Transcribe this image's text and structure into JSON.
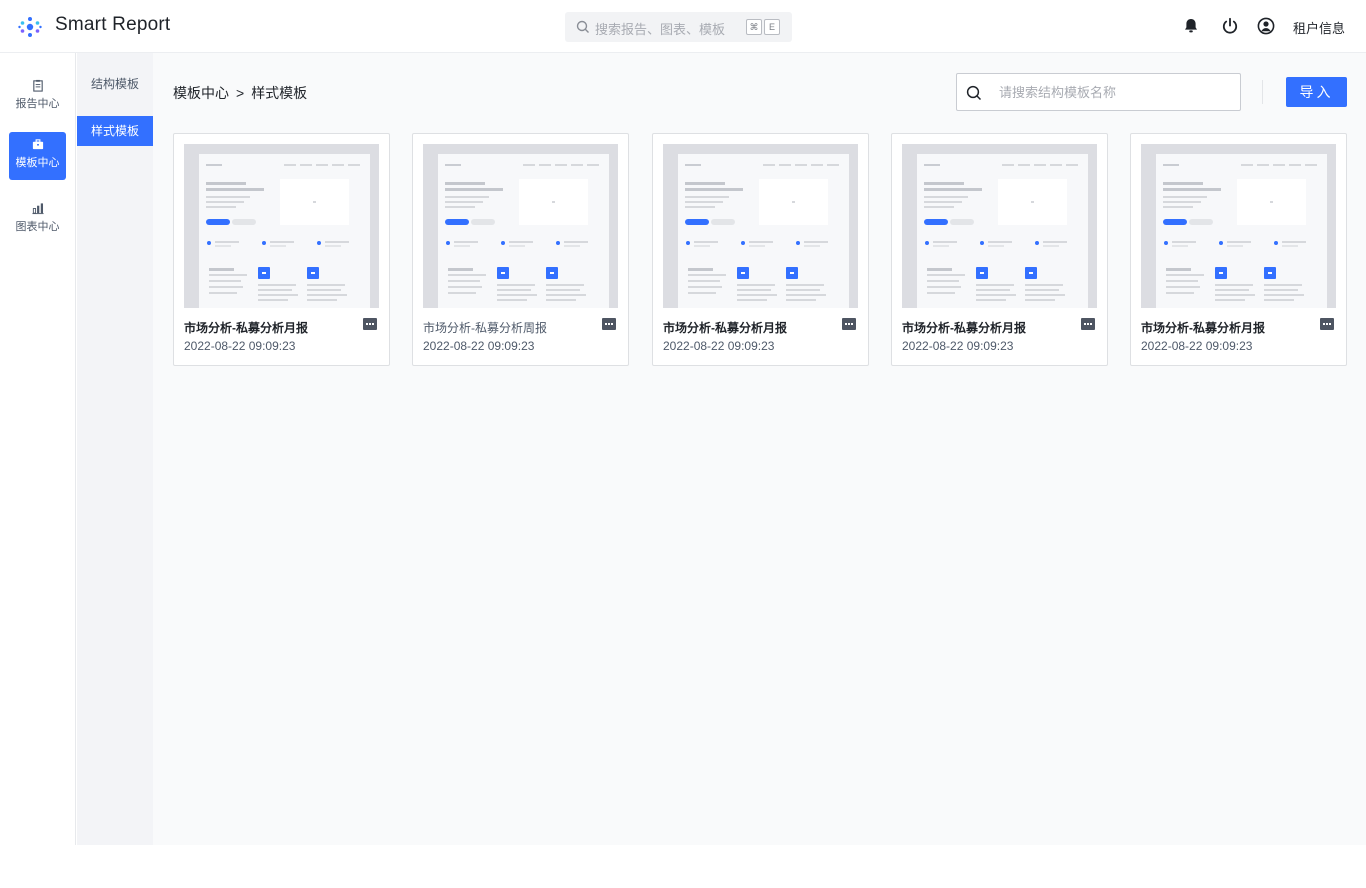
{
  "app": {
    "title": "Smart Report"
  },
  "global_search": {
    "placeholder": "搜索报告、图表、模板",
    "shortcut_keys": [
      "⌘",
      "E"
    ]
  },
  "header_right": {
    "tenant_label": "租户信息",
    "icons": [
      "bell-icon",
      "power-icon",
      "user-icon"
    ]
  },
  "rail": {
    "items": [
      {
        "label": "报告中心",
        "icon": "clipboard-icon",
        "active": false
      },
      {
        "label": "模板中心",
        "icon": "briefcase-icon",
        "active": true
      },
      {
        "label": "图表中心",
        "icon": "bar-chart-icon",
        "active": false
      }
    ]
  },
  "subnav": {
    "items": [
      {
        "label": "结构模板",
        "active": false
      },
      {
        "label": "样式模板",
        "active": true
      }
    ]
  },
  "breadcrumb": {
    "root": "模板中心",
    "separator": ">",
    "current": "样式模板"
  },
  "template_search": {
    "placeholder": "请搜索结构模板名称"
  },
  "import_button": {
    "label": "导入"
  },
  "colors": {
    "accent": "#3370ff",
    "thumb_bg": "#dcdde2"
  },
  "cards": [
    {
      "title": "市场分析-私募分析月报",
      "time": "2022-08-22 09:09:23"
    },
    {
      "title": "市场分析-私募分析周报",
      "time": "2022-08-22 09:09:23"
    },
    {
      "title": "市场分析-私募分析月报",
      "time": "2022-08-22 09:09:23"
    },
    {
      "title": "市场分析-私募分析月报",
      "time": "2022-08-22 09:09:23"
    },
    {
      "title": "市场分析-私募分析月报",
      "time": "2022-08-22 09:09:23"
    }
  ]
}
